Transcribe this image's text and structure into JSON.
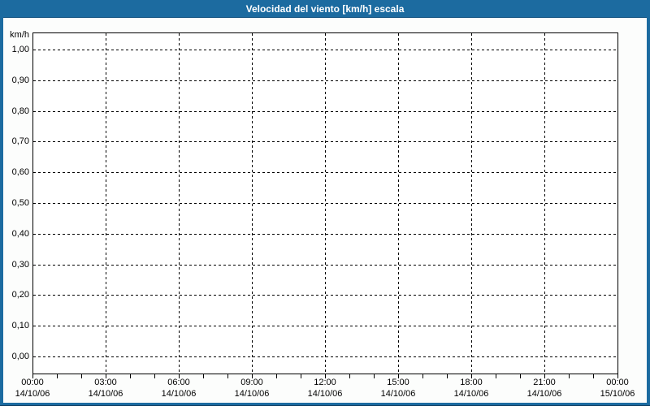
{
  "title_bar": {
    "title": "Velocidad del viento [km/h] escala",
    "bg_color": "#1c6ba0",
    "text_color": "#ffffff"
  },
  "frame": {
    "border_color": "#1c6ba0",
    "background": "#ffffff"
  },
  "chart_data": {
    "type": "line",
    "title": "Velocidad del viento [km/h] escala",
    "ylabel": "km/h",
    "xlabel": "",
    "ylim": [
      0.0,
      1.0
    ],
    "y_step": 0.1,
    "grid": {
      "style": "dashed",
      "color": "#000000"
    },
    "legend_position": "none",
    "series": [],
    "y_axis": {
      "unit": "km/h",
      "tick_labels": [
        "1,00",
        "0,90",
        "0,80",
        "0,70",
        "0,60",
        "0,50",
        "0,40",
        "0,30",
        "0,20",
        "0,10",
        "0,00"
      ],
      "tick_values": [
        1.0,
        0.9,
        0.8,
        0.7,
        0.6,
        0.5,
        0.4,
        0.3,
        0.2,
        0.1,
        0.0
      ]
    },
    "x_axis": {
      "span_hours": 24,
      "minor_tick_every_hours": 1,
      "major_tick_every_hours": 3,
      "major_ticks": [
        {
          "time": "00:00",
          "date": "14/10/06"
        },
        {
          "time": "03:00",
          "date": "14/10/06"
        },
        {
          "time": "06:00",
          "date": "14/10/06"
        },
        {
          "time": "09:00",
          "date": "14/10/06"
        },
        {
          "time": "12:00",
          "date": "14/10/06"
        },
        {
          "time": "15:00",
          "date": "14/10/06"
        },
        {
          "time": "18:00",
          "date": "14/10/06"
        },
        {
          "time": "21:00",
          "date": "14/10/06"
        },
        {
          "time": "00:00",
          "date": "15/10/06"
        }
      ]
    }
  }
}
